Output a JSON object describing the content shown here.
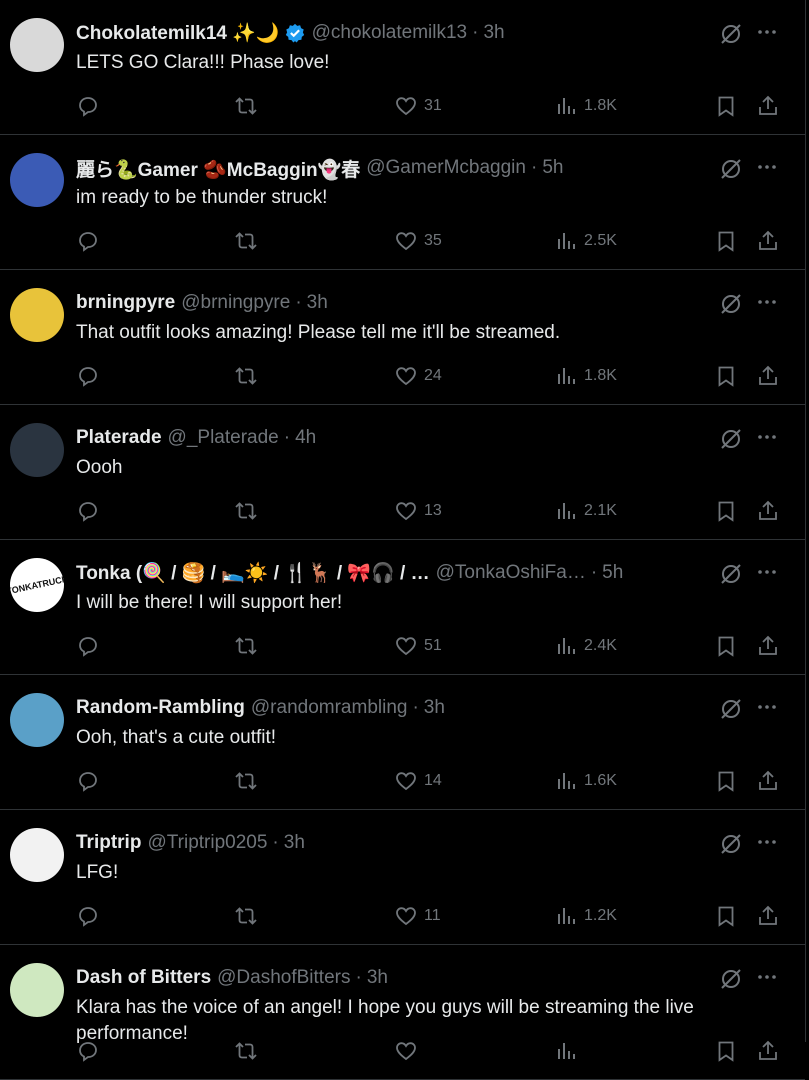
{
  "tweets": [
    {
      "name": "Chokolatemilk14 ✨🌙",
      "handle": "@chokolatemilk13",
      "time": "3h",
      "verified": true,
      "text": "LETS GO Clara!!! Phase love!",
      "reply": "",
      "retweet": "",
      "likes": "31",
      "views": "1.8K",
      "avatar_color": "#d9d9d9"
    },
    {
      "name": "麗ら🐍Gamer 🫘McBaggin👻春",
      "handle": "@GamerMcbaggin",
      "time": "5h",
      "verified": false,
      "text": "im ready to be thunder struck!",
      "reply": "",
      "retweet": "",
      "likes": "35",
      "views": "2.5K",
      "avatar_color": "#3b5bb5"
    },
    {
      "name": "brningpyre",
      "handle": "@brningpyre",
      "time": "3h",
      "verified": false,
      "text": "That outfit looks amazing! Please tell me it'll be streamed.",
      "reply": "",
      "retweet": "",
      "likes": "24",
      "views": "1.8K",
      "avatar_color": "#e8c33a"
    },
    {
      "name": "Platerade",
      "handle": "@_Platerade",
      "time": "4h",
      "verified": false,
      "text": "Oooh",
      "reply": "",
      "retweet": "",
      "likes": "13",
      "views": "2.1K",
      "avatar_color": "#2a3440"
    },
    {
      "name": "Tonka (🍭 / 🥞 / 🛌☀️ / 🍴🦌 / 🎀🎧 / …",
      "handle": "@TonkaOshiFa…",
      "time": "5h",
      "verified": false,
      "text": "I will be there! I will support her!",
      "reply": "",
      "retweet": "",
      "likes": "51",
      "views": "2.4K",
      "avatar_color": "#ffffff",
      "avatar_text": "TONKATRUCK"
    },
    {
      "name": "Random-Rambling",
      "handle": "@randomrambling",
      "time": "3h",
      "verified": false,
      "text": "Ooh, that's a cute outfit!",
      "reply": "",
      "retweet": "",
      "likes": "14",
      "views": "1.6K",
      "avatar_color": "#5aa0c8"
    },
    {
      "name": "Triptrip",
      "handle": "@Triptrip0205",
      "time": "3h",
      "verified": false,
      "text": "LFG!",
      "reply": "",
      "retweet": "",
      "likes": "11",
      "views": "1.2K",
      "avatar_color": "#f2f2f2"
    },
    {
      "name": "Dash of Bitters",
      "handle": "@DashofBitters",
      "time": "3h",
      "verified": false,
      "text": "Klara has the voice of an angel! I hope you guys will be streaming the live performance!",
      "reply": "",
      "retweet": "",
      "likes": "",
      "views": "",
      "avatar_color": "#cfe8c0"
    }
  ],
  "icons": {
    "reply": "reply-icon",
    "retweet": "retweet-icon",
    "like": "heart-icon",
    "views": "views-icon",
    "bookmark": "bookmark-icon",
    "share": "share-icon",
    "grok": "grok-icon",
    "more": "more-icon",
    "verified": "verified-badge-icon"
  },
  "colors": {
    "background": "#000000",
    "text": "#e7e9ea",
    "muted": "#71767b",
    "divider": "#2f3336",
    "verified": "#1d9bf0"
  }
}
